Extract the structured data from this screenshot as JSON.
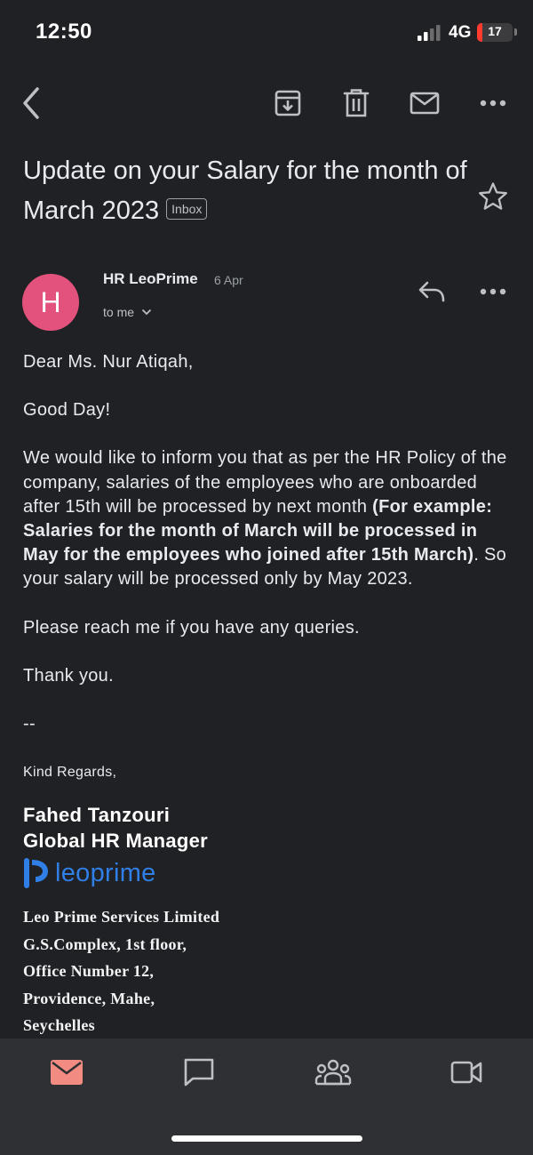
{
  "status_bar": {
    "time": "12:50",
    "network": "4G",
    "battery": "17"
  },
  "toolbar": {
    "icons": [
      "back-arrow-icon",
      "archive-icon",
      "trash-icon",
      "mark-unread-mail-icon",
      "more-horizontal-icon"
    ]
  },
  "email": {
    "subject": "Update on your Salary for the month of March 2023",
    "label": "Inbox",
    "sender": "HR LeoPrime",
    "sender_initial": "H",
    "date": "6 Apr",
    "recipient": "to me",
    "greeting": "Dear Ms. Nur Atiqah,",
    "good_day": "Good Day!",
    "para_intro": "We would like to inform you that as per the HR Policy of the company, salaries of the employees who are onboarded after 15th will be processed by next month ",
    "para_bold": "(For example: Salaries for the month of March will be processed in May for the employees who joined after 15th March)",
    "para_end": ". So your salary will be processed only by May 2023.",
    "reach_out": "Please reach me if you have any queries.",
    "thanks": "Thank you.",
    "separator": "--",
    "regards": "Kind Regards,",
    "signature": {
      "name": "Fahed Tanzouri",
      "title": "Global HR Manager",
      "logo_text": "leoprime",
      "company": "Leo Prime Services Limited",
      "address_1": "G.S.Complex, 1st floor,",
      "address_2": "Office Number 12,",
      "address_3": "Providence, Mahe,",
      "address_4": "Seychelles"
    }
  },
  "colors": {
    "background": "#202124",
    "avatar": "#e2527c",
    "active_nav": "#f28b82",
    "logo": "#2f7fe6"
  },
  "bottom_nav": {
    "icons": [
      "mail-icon",
      "chat-icon",
      "spaces-icon",
      "meet-video-icon"
    ],
    "active": "mail-icon"
  }
}
